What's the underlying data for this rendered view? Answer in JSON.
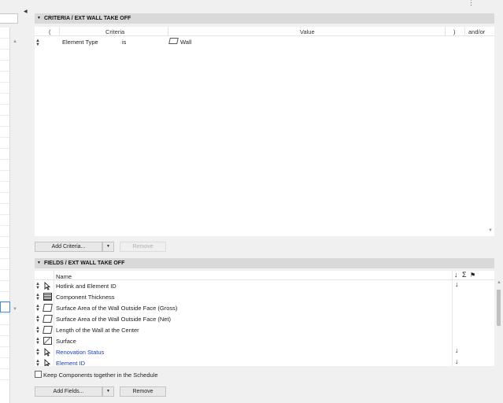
{
  "criteria": {
    "header_title": "CRITERIA /  EXT WALL TAKE OFF",
    "columns": {
      "open_paren": "(",
      "criteria": "Criteria",
      "value": "Value",
      "close_paren": ")",
      "andor": "and/or"
    },
    "rows": [
      {
        "criteria": "Element Type",
        "operator": "is",
        "value": "Wall"
      }
    ],
    "add_button": "Add Criteria...",
    "remove_button": "Remove"
  },
  "fields": {
    "header_title": "FIELDS /  EXT WALL TAKE OFF",
    "column_name": "Name",
    "rows": [
      {
        "label": "Hotlink and Element ID",
        "icon": "cursor-icon",
        "sorted": true,
        "linked": false
      },
      {
        "label": "Component Thickness",
        "icon": "layers-icon",
        "sorted": false,
        "linked": false
      },
      {
        "label": "Surface Area of the Wall Outside Face (Gross)",
        "icon": "wall-face-icon",
        "sorted": false,
        "linked": false
      },
      {
        "label": "Surface Area of the Wall Outside Face (Net)",
        "icon": "wall-face-icon",
        "sorted": false,
        "linked": false
      },
      {
        "label": "Length of the Wall at the Center",
        "icon": "wall-face-icon",
        "sorted": false,
        "linked": false
      },
      {
        "label": "Surface",
        "icon": "surface-icon",
        "sorted": false,
        "linked": false
      },
      {
        "label": "Renovation Status",
        "icon": "cursor-icon",
        "sorted": true,
        "linked": true
      },
      {
        "label": "Element ID",
        "icon": "cursor-icon",
        "sorted": true,
        "linked": true
      }
    ],
    "keep_components_label": "Keep Components together in the Schedule",
    "keep_components_checked": false,
    "add_button": "Add Fields...",
    "remove_button": "Remove"
  },
  "colors": {
    "link_blue": "#1a3fbf",
    "header_bg": "#d9d9d9",
    "selection": "#3a8ee6"
  }
}
